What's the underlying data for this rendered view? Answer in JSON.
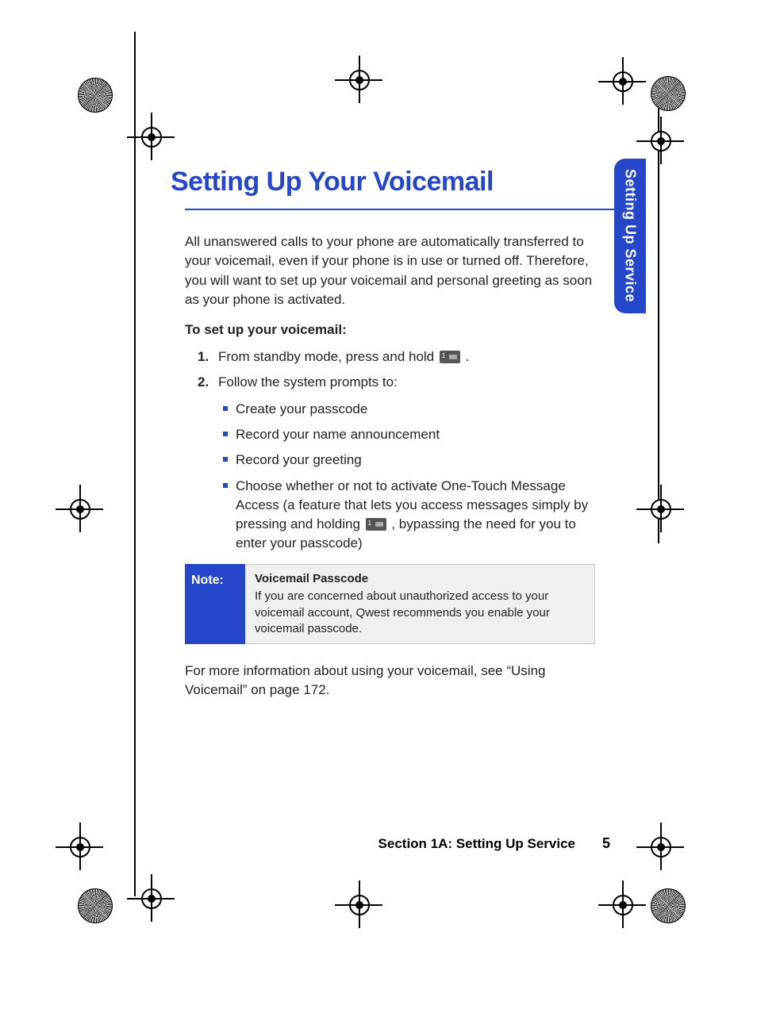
{
  "sidetab": {
    "label": "Setting Up Service"
  },
  "heading": "Setting Up Your Voicemail",
  "intro": "All unanswered calls to your phone are automatically transferred to your voicemail, even if your phone is in use or turned off. Therefore, you will want to set up your voicemail and personal greeting as soon as your phone is activated.",
  "subhead": "To set up your voicemail:",
  "steps": {
    "one_a": "From standby mode, press and hold ",
    "one_b": ".",
    "two": "Follow the system prompts to:",
    "sub": {
      "a": "Create your passcode",
      "b": "Record your name announcement",
      "c": "Record your greeting",
      "d_a": "Choose whether or not to activate One-Touch Message Access (a feature that lets you access messages simply by pressing and holding ",
      "d_b": ", bypassing the need for you to enter your passcode)"
    }
  },
  "note": {
    "label": "Note:",
    "title": "Voicemail Passcode",
    "body": "If you are concerned about unauthorized access to your voicemail account, Qwest recommends you enable your voicemail passcode."
  },
  "outro": "For more information about using your voicemail, see “Using Voicemail” on page 172.",
  "footer": {
    "section": "Section 1A: Setting Up Service",
    "page": "5"
  }
}
